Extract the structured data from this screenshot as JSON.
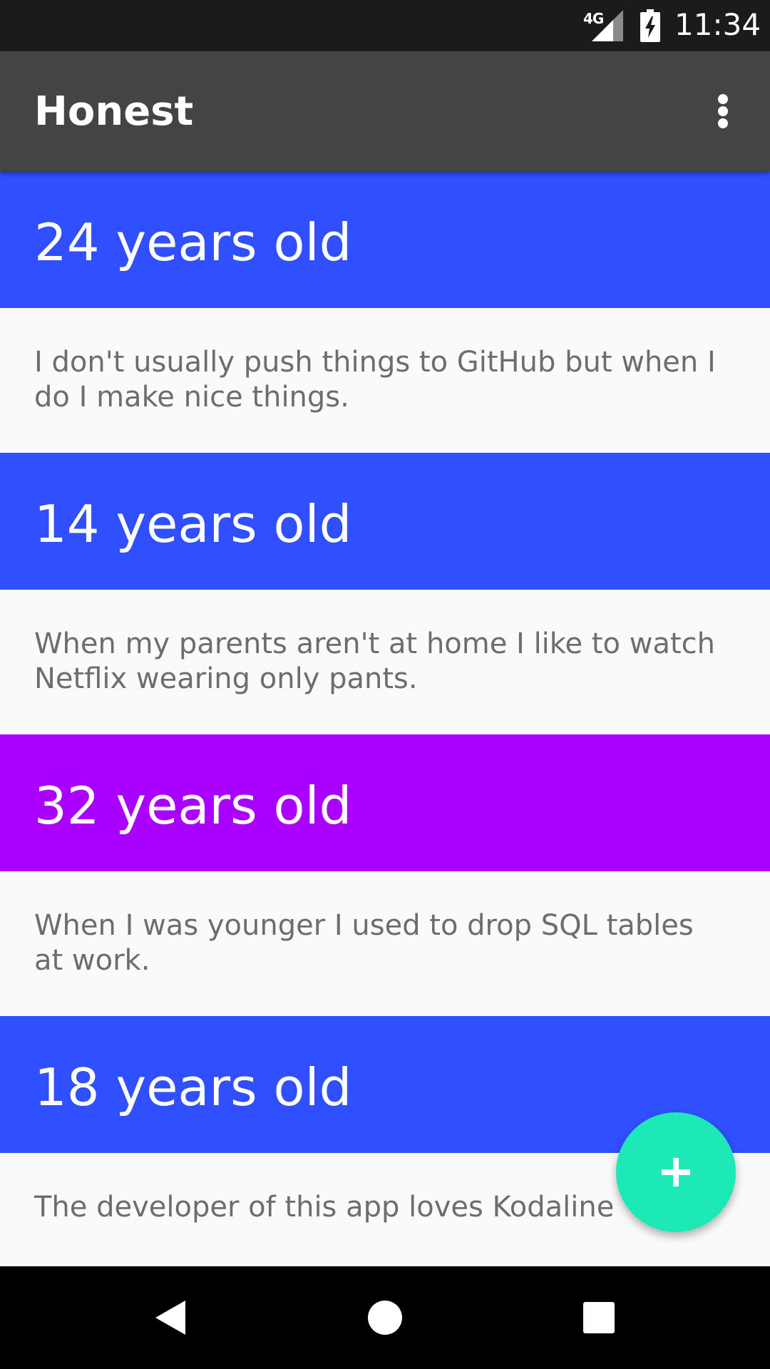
{
  "status_bar": {
    "network": "4G",
    "time": "11:34",
    "icons": [
      "signal-icon",
      "battery-charging-icon"
    ]
  },
  "app_bar": {
    "title": "Honest",
    "menu_icon": "more-vert-icon"
  },
  "posts": [
    {
      "age_label": "24 years old",
      "color": "#304ffe",
      "message": "I don't usually push things to GitHub but when I do I make nice things."
    },
    {
      "age_label": "14 years old",
      "color": "#304ffe",
      "message": "When my parents aren't at home I like to watch Netflix wearing only pants."
    },
    {
      "age_label": "32 years old",
      "color": "#aa00ff",
      "message": "When I was younger I used to drop SQL tables at work."
    },
    {
      "age_label": "18 years old",
      "color": "#304ffe",
      "message": "The developer of this app loves Kodaline"
    }
  ],
  "fab": {
    "icon": "add-icon",
    "color": "#1de9b6"
  },
  "nav_bar": {
    "icons": [
      "back-icon",
      "home-icon",
      "recents-icon"
    ]
  }
}
